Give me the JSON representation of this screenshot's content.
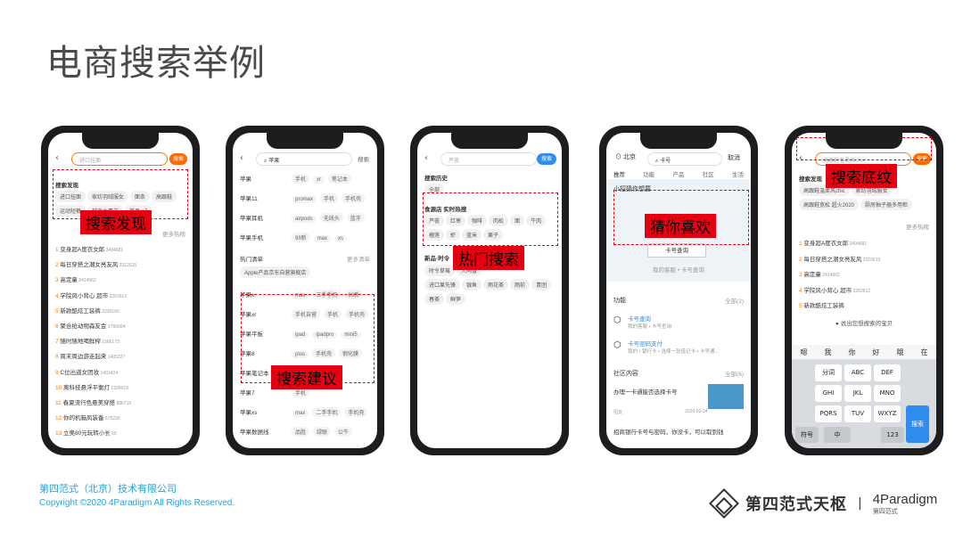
{
  "title": "电商搜索举例",
  "footer": {
    "company": "第四范式（北京）技术有限公司",
    "copyright": "Copyright ©2020 4Paradigm All Rights Reserved.",
    "brand_cn": "第四范式天枢",
    "brand_en": "4Paradigm",
    "brand_sub": "第四范式"
  },
  "labels": {
    "discovery": "搜索发现",
    "suggestion": "搜索建议",
    "hot": "热门搜索",
    "guess": "猜你喜欢",
    "shading": "搜索底纹"
  },
  "phone1": {
    "search_placeholder": "进口挂面",
    "search_btn": "搜索",
    "section": "搜索发现",
    "chips": [
      "进口挂面",
      "家纺羽绒服女",
      "面条",
      "高跟鞋",
      "运动短裤",
      "越南大青芒",
      "苹果m7"
    ],
    "more": "更多热榜",
    "list": [
      {
        "rank": "1",
        "text": "变身超A度衣女郎",
        "count": "3494681"
      },
      {
        "rank": "2",
        "text": "每日穿搭之潮女亮友风",
        "count": "3312615"
      },
      {
        "rank": "3",
        "text": "高定童",
        "count": "2414962"
      },
      {
        "rank": "4",
        "text": "学院风小背心 超市",
        "count": "2262612"
      },
      {
        "rank": "5",
        "text": "新款酷炫工装裤",
        "count": "2230160"
      },
      {
        "rank": "6",
        "text": "聚合抢动物森友会",
        "count": "1766004"
      },
      {
        "rank": "7",
        "text": "随时随地喝鲜榨",
        "count": "1566173"
      },
      {
        "rank": "8",
        "text": "周末周边游走起来",
        "count": "1405327"
      },
      {
        "rank": "9",
        "text": "C位出道女团妆",
        "count": "1403424"
      },
      {
        "rank": "10",
        "text": "离科技悬浮平衡灯",
        "count": "1328619"
      },
      {
        "rank": "11",
        "text": "春夏流行色悬美穿搭",
        "count": "886715"
      },
      {
        "rank": "12",
        "text": "你的机箱风装备",
        "count": "675239"
      },
      {
        "rank": "13",
        "text": "立奥80元玩转小长",
        "count": "65"
      }
    ]
  },
  "phone2": {
    "search_value": "苹果",
    "search_btn": "搜索",
    "rows": [
      {
        "name": "苹果",
        "tags": [
          "手机",
          "xr",
          "笔记本"
        ]
      },
      {
        "name": "苹果11",
        "tags": [
          "promax",
          "手机",
          "手机壳"
        ]
      },
      {
        "name": "苹果耳机",
        "tags": [
          "airpods",
          "无线头",
          "蓝牙"
        ]
      },
      {
        "name": "苹果手机",
        "tags": [
          "99新",
          "max",
          "xs"
        ]
      }
    ],
    "hot_list": "热门清单",
    "hot_more": "更多清单",
    "hot_item": "Apple产品京东自营旗舰店",
    "rows2": [
      {
        "name": "苹果x",
        "tags": [
          "max",
          "二手手机",
          "99新"
        ]
      },
      {
        "name": "苹果xr",
        "tags": [
          "手机自营",
          "手机",
          "手机壳"
        ]
      },
      {
        "name": "苹果平板",
        "tags": [
          "ipad",
          "ipadpro",
          "mini5"
        ]
      },
      {
        "name": "苹果8",
        "tags": [
          "plus",
          "手机壳",
          "钢化膜"
        ]
      },
      {
        "name": "苹果笔记本",
        "tags": [
          "",
          "",
          "二手"
        ]
      },
      {
        "name": "苹果7",
        "tags": [
          "",
          "",
          "手机"
        ]
      },
      {
        "name": "苹果xs",
        "tags": [
          "max",
          "二手手机",
          "手机壳"
        ]
      },
      {
        "name": "苹果数据线",
        "tags": [
          "品胜",
          "绿联",
          "公牛"
        ]
      }
    ]
  },
  "phone3": {
    "search_placeholder": "芦荟",
    "search_btn": "搜索",
    "history": "搜索历史",
    "history_item": "全部",
    "hot_title": "食源店 实时热搜",
    "hot_row1": [
      "芦荟",
      "红枣",
      "咖啡",
      "肉松",
      "面",
      "牛肉"
    ],
    "hot_row2": [
      "榴莲",
      "虾",
      "蓝米",
      "栗子"
    ],
    "new_title": "新品·时令",
    "new_rows": [
      [
        "时令草莓",
        "",
        "",
        "大闸蟹"
      ],
      [
        "进口果先锋",
        "银鱼",
        "雨花茶",
        "雨前",
        "青团"
      ],
      [
        "春茶",
        "鲜笋"
      ]
    ]
  },
  "phone4": {
    "city": "北京",
    "search_value": "卡号",
    "cancel": "取消",
    "tabs": [
      "推荐",
      "功能",
      "产品",
      "社区",
      "生活"
    ],
    "guess_title": "小招猜你想要",
    "card_btn": "卡号查询",
    "card_sub": "我的客服 • 卡号查询",
    "func_title": "功能",
    "func_all": "全部(2)",
    "func_items": [
      {
        "title": "卡号查询",
        "sub": "我的客服 • 卡号查询"
      },
      {
        "title": "卡号密码支付",
        "sub": "我的 • 银行卡 • 选择一张借记卡 • 卡号通..."
      }
    ],
    "community": "社区内容",
    "community_all": "全部(6)",
    "post_title": "办理一卡通能否选择卡号",
    "post_date": "2020-03-24",
    "post_user": "招友",
    "post2": "招商银行卡号与密码，你没卡，可以取到钱"
  },
  "phone5": {
    "search_placeholder": "高跟鞋温柔风chic",
    "search_btn": "搜索",
    "section": "搜索发现",
    "chips": [
      "高跟鞋温柔风chic",
      "家纺羽绒服女",
      "高跟鞋宽松 超火2020",
      "厨房柚子器多用柜"
    ],
    "more": "更多热榜",
    "list": [
      {
        "rank": "1",
        "text": "变身超A度衣女郎",
        "count": "3494681"
      },
      {
        "rank": "2",
        "text": "每日穿搭之潮女亮友风",
        "count": "3310615"
      },
      {
        "rank": "3",
        "text": "高定童",
        "count": "2414962"
      },
      {
        "rank": "4",
        "text": "学院风小背心 超市",
        "count": "2262612"
      },
      {
        "rank": "5",
        "text": "新款酷炫工装裤",
        "count": ""
      }
    ],
    "voice_hint": "说出您想搜索的宝贝",
    "kb_top": [
      "嗯",
      "我",
      "你",
      "好",
      "哦",
      "在"
    ],
    "keys": [
      "分词",
      "ABC",
      "DEF",
      "GHI",
      "JKL",
      "MNO",
      "PQRS",
      "TUV",
      "WXYZ"
    ],
    "send": "搜索",
    "bottom": [
      "符号",
      "中",
      "123"
    ]
  }
}
